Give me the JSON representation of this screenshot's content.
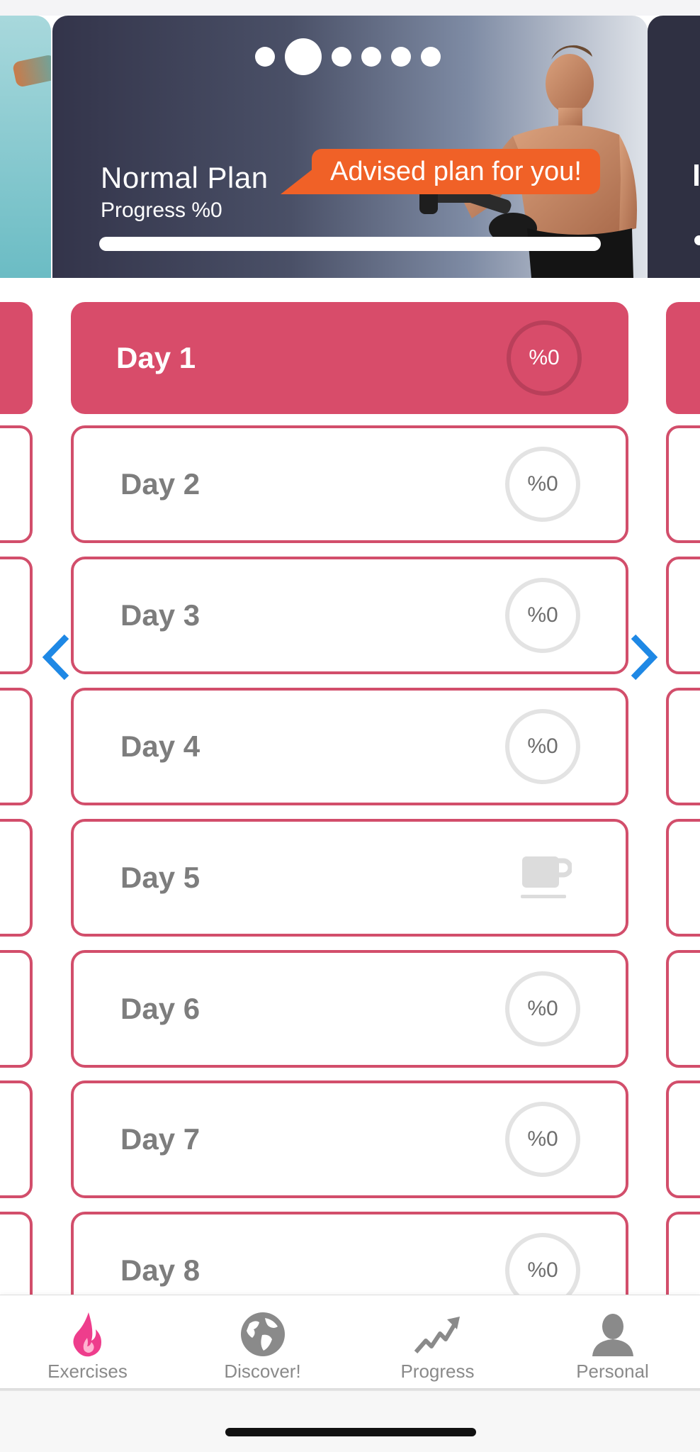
{
  "banner": {
    "plan_title": "Normal Plan",
    "progress_label": "Progress %0",
    "progress_value": 0,
    "advice": "Advised plan for you!",
    "pages": 6,
    "active_page": 1
  },
  "days": [
    {
      "label": "Day 1",
      "progress": "%0",
      "rest": false,
      "active": true
    },
    {
      "label": "Day 2",
      "progress": "%0",
      "rest": false,
      "active": false
    },
    {
      "label": "Day 3",
      "progress": "%0",
      "rest": false,
      "active": false
    },
    {
      "label": "Day 4",
      "progress": "%0",
      "rest": false,
      "active": false
    },
    {
      "label": "Day 5",
      "progress": "",
      "rest": true,
      "active": false
    },
    {
      "label": "Day 6",
      "progress": "%0",
      "rest": false,
      "active": false
    },
    {
      "label": "Day 7",
      "progress": "%0",
      "rest": false,
      "active": false
    },
    {
      "label": "Day 8",
      "progress": "%0",
      "rest": false,
      "active": false
    }
  ],
  "tabs": [
    {
      "label": "Exercises",
      "icon": "flame-icon",
      "selected": true
    },
    {
      "label": "Discover!",
      "icon": "globe-icon",
      "selected": false
    },
    {
      "label": "Progress",
      "icon": "trend-arrow-icon",
      "selected": false
    },
    {
      "label": "Personal",
      "icon": "person-icon",
      "selected": false
    }
  ],
  "colors": {
    "accent": "#d84c6a",
    "bubble": "#f06127",
    "nav_arrow": "#1e88e5"
  }
}
